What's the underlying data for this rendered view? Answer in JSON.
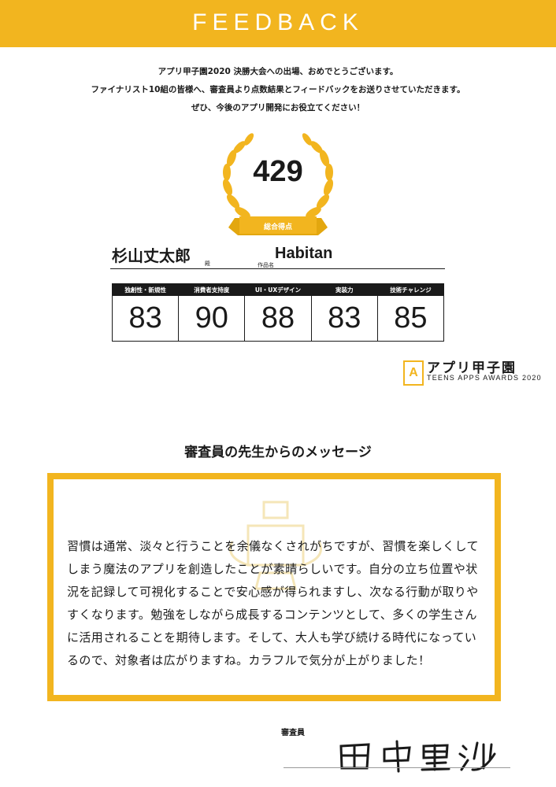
{
  "header": {
    "title": "FEEDBACK"
  },
  "intro": {
    "line1": "アプリ甲子園2020 決勝大会への出場、おめでとうございます。",
    "line2": "ファイナリスト10組の皆様へ、審査員より点数結果とフィードバックをお送りさせていただきます。",
    "line3": "ぜひ、今後のアプリ開発にお役立てください！"
  },
  "total": {
    "score": "429",
    "label": "総合得点"
  },
  "entrant": {
    "name": "杉山丈太郎",
    "honorific": "殿",
    "work_label": "作品名",
    "work": "Habitan"
  },
  "scores": [
    {
      "label": "独創性・新規性",
      "value": "83"
    },
    {
      "label": "消費者支持度",
      "value": "90"
    },
    {
      "label": "UI・UXデザイン",
      "value": "88"
    },
    {
      "label": "実装力",
      "value": "83"
    },
    {
      "label": "技術チャレンジ",
      "value": "85"
    }
  ],
  "logo": {
    "mark": "A",
    "jp": "アプリ甲子園",
    "en": "TEENS APPS AWARDS 2020"
  },
  "message": {
    "heading": "審査員の先生からのメッセージ",
    "body": "習慣は通常、淡々と行うことを余儀なくされがちですが、習慣を楽しくしてしまう魔法のアプリを創造したことが素晴らしいです。自分の立ち位置や状況を記録して可視化することで安心感が得られますし、次なる行動が取りやすくなります。勉強をしながら成長するコンテンツとして、多くの学生さんに活用されることを期待します。そして、大人も学び続ける時代になっているので、対象者は広がりますね。カラフルで気分が上がりました！"
  },
  "judge": {
    "label": "審査員",
    "signature": "田中里沙"
  },
  "colors": {
    "accent": "#f2b51f",
    "dark": "#1a1a1a"
  }
}
